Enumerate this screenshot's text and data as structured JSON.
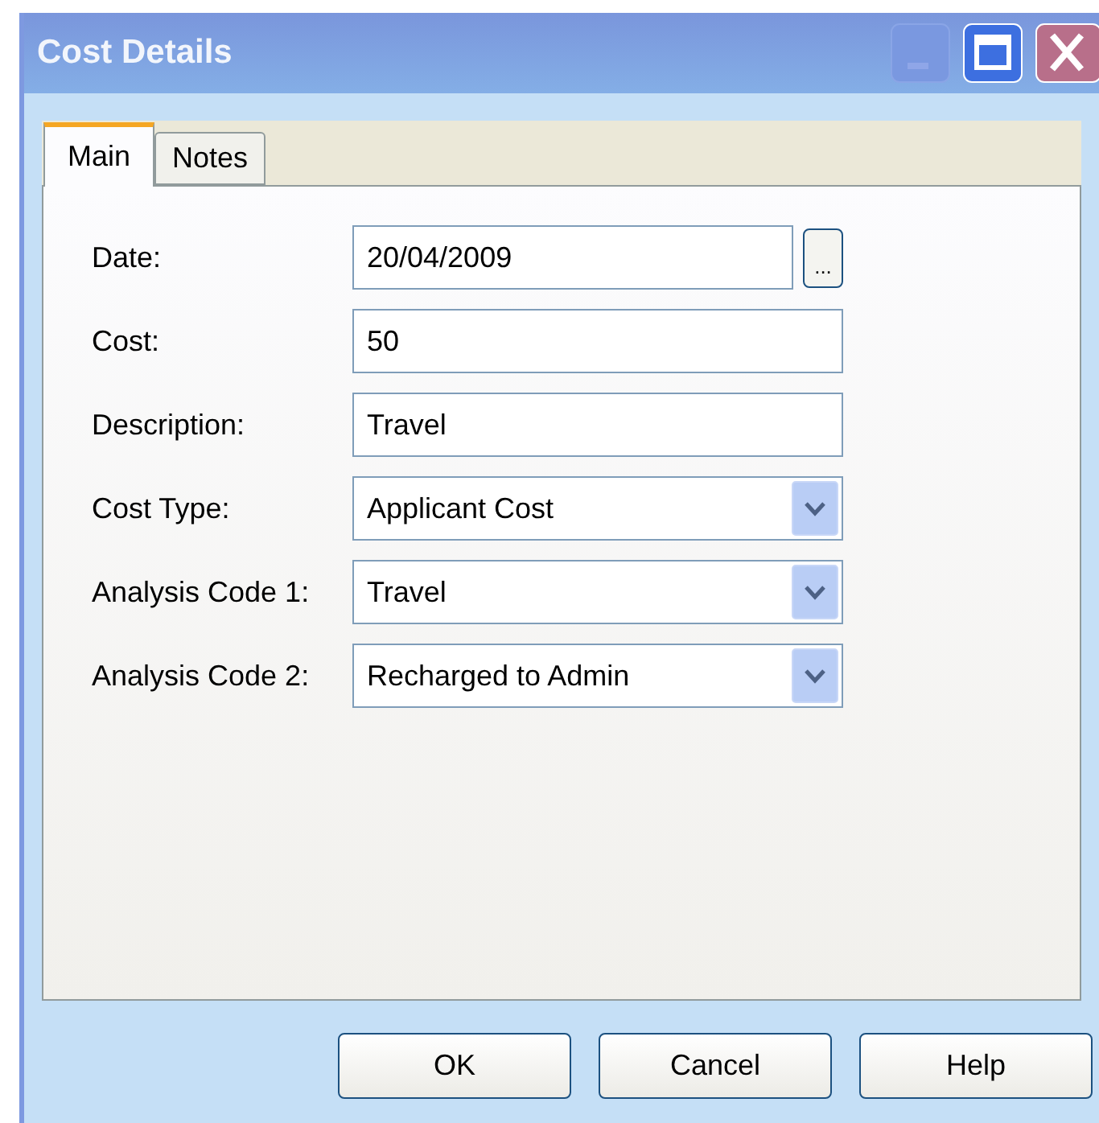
{
  "window": {
    "title": "Cost Details"
  },
  "tabs": [
    {
      "label": "Main",
      "selected": true
    },
    {
      "label": "Notes",
      "selected": false
    }
  ],
  "fields": [
    {
      "kind": "date",
      "label": "Date:",
      "value": "20/04/2009",
      "button": "..."
    },
    {
      "kind": "text",
      "label": "Cost:",
      "value": "50"
    },
    {
      "kind": "text",
      "label": "Description:",
      "value": "Travel"
    },
    {
      "kind": "select",
      "label": "Cost Type:",
      "value": "Applicant Cost"
    },
    {
      "kind": "select",
      "label": "Analysis Code 1:",
      "value": "Travel"
    },
    {
      "kind": "select",
      "label": "Analysis Code 2:",
      "value": "Recharged to Admin"
    }
  ],
  "buttons": [
    "OK",
    "Cancel",
    "Help"
  ]
}
